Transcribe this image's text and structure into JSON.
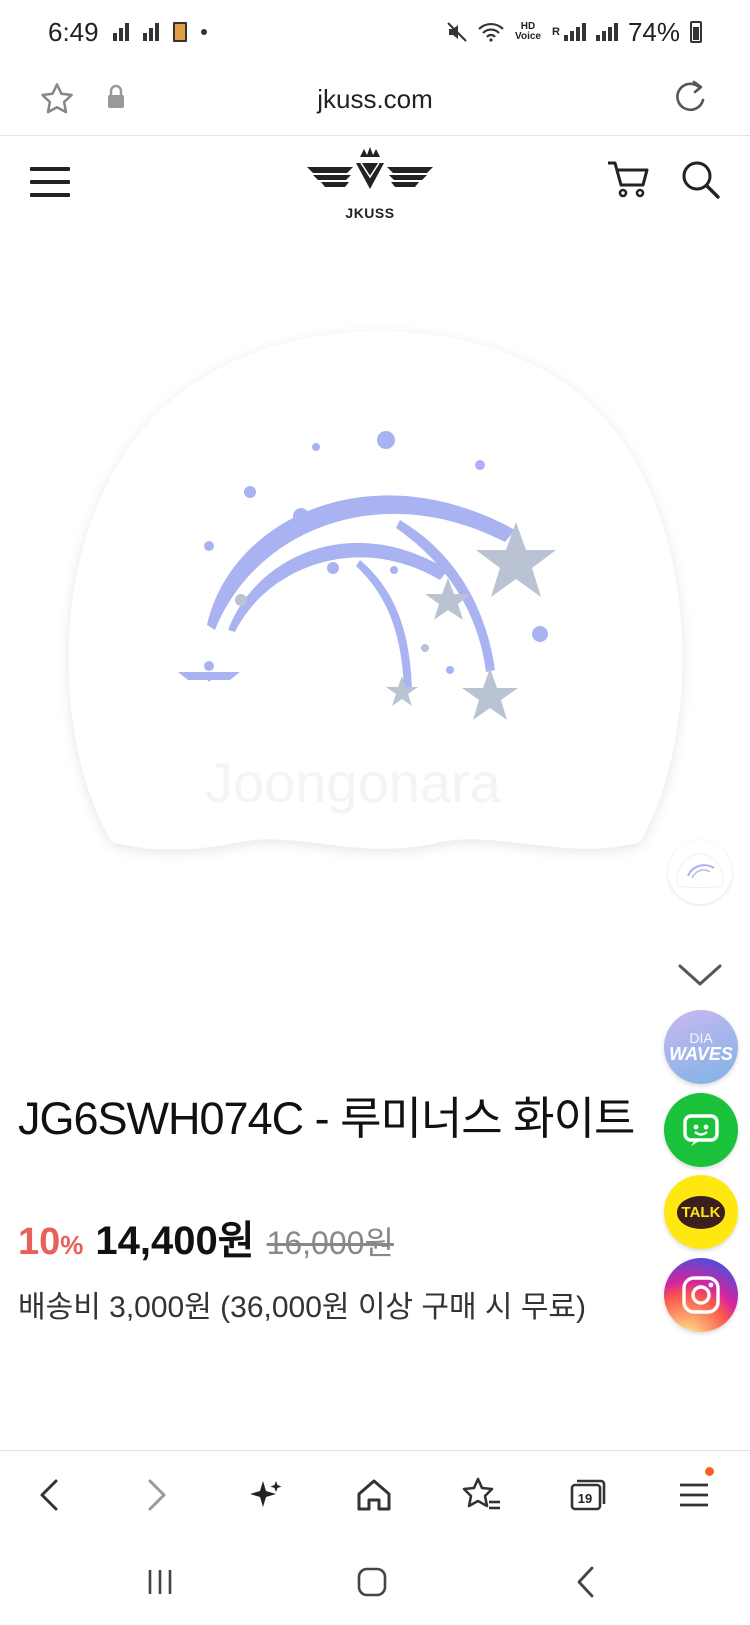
{
  "status_bar": {
    "time": "6:49",
    "battery": "74%",
    "network_label": "HD Voice",
    "carrier_flag": "R"
  },
  "browser": {
    "url": "jkuss.com"
  },
  "site": {
    "brand": "JKUSS",
    "icons": [
      "menu-icon",
      "cart-icon",
      "search-icon"
    ]
  },
  "product": {
    "watermark": "Joongonara",
    "title": "JG6SWH074C - 루미너스 화이트",
    "discount_value": "10",
    "discount_unit": "%",
    "sale_price": "14,400원",
    "original_price": "16,000원",
    "shipping": "배송비 3,000원 (36,000원 이상 구매 시 무료)"
  },
  "floating": {
    "dia_top": "DIA",
    "dia_bottom": "WAVES",
    "kakao": "TALK"
  },
  "browser_bottom": {
    "tab_count": "19",
    "items": [
      "back-icon",
      "forward-icon",
      "sparkle-icon",
      "home-icon",
      "bookmarks-icon",
      "tabs-icon",
      "menu-icon"
    ]
  },
  "colors": {
    "discount": "#e8605a",
    "kakao": "#ffe812",
    "line_green": "#19c23a",
    "star_silver": "#b9c3d3",
    "swirl_lavender": "#a9b3f2"
  }
}
